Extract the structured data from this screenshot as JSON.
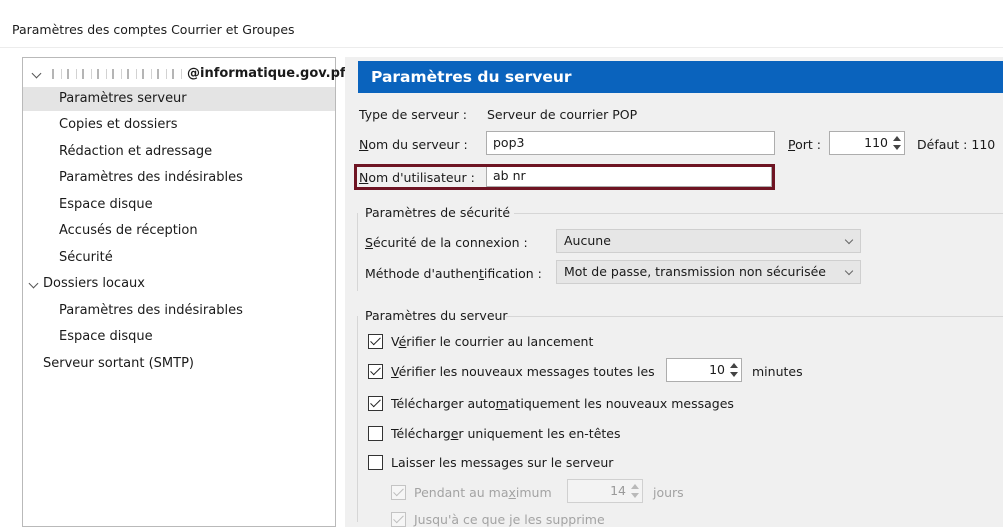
{
  "window": {
    "title": "Paramètres des comptes Courrier et Groupes"
  },
  "sidebar": {
    "account_suffix": "@informatique.gov.pf",
    "items": [
      {
        "label": "Paramètres serveur"
      },
      {
        "label": "Copies et dossiers"
      },
      {
        "label": "Rédaction et adressage"
      },
      {
        "label": "Paramètres des indésirables"
      },
      {
        "label": "Espace disque"
      },
      {
        "label": "Accusés de réception"
      },
      {
        "label": "Sécurité"
      },
      {
        "label": "Dossiers locaux"
      },
      {
        "label": "Paramètres des indésirables"
      },
      {
        "label": "Espace disque"
      },
      {
        "label": "Serveur sortant (SMTP)"
      }
    ]
  },
  "panel": {
    "title": "Paramètres du serveur",
    "server_type_label": "Type de serveur :",
    "server_type_value": "Serveur de courrier POP",
    "server_name_label": "om du serveur :",
    "server_name_mnemonic": "N",
    "server_name_value": "pop3",
    "port_label": "ort :",
    "port_mnemonic": "P",
    "port_value": "110",
    "default_label": "Défaut :",
    "default_value": "110",
    "username_label": "om d'utilisateur :",
    "username_mnemonic": "N",
    "username_value": "ab   nr"
  },
  "security": {
    "group_title": "Paramètres de sécurité",
    "connection_label": "écurité de la connexion :",
    "connection_mnemonic": "S",
    "connection_value": "Aucune",
    "auth_label_pre": "Méthode d'authen",
    "auth_label_mnemonic": "t",
    "auth_label_post": "ification :",
    "auth_value": "Mot de passe, transmission non sécurisée"
  },
  "server_settings": {
    "group_title": "Paramètres du serveur",
    "check_on_startup": {
      "pre": "V",
      "mn": "é",
      "post": "rifier le courrier au lancement",
      "checked": true
    },
    "check_every": {
      "pre": "",
      "mn": "V",
      "post": "érifier les nouveaux messages toutes les",
      "checked": true,
      "value": "10",
      "unit": "minutes"
    },
    "auto_download": {
      "pre": "Télécharger auto",
      "mn": "m",
      "post": "atiquement les nouveaux messages",
      "checked": true
    },
    "headers_only": {
      "pre": "Télécharg",
      "mn": "e",
      "post": "r uniquement les en-têtes",
      "checked": false
    },
    "leave_on_server": {
      "pre": "Laisser les messages sur le serveur",
      "mn": "",
      "post": "",
      "checked": false
    },
    "max_days": {
      "pre": "Pendant au ma",
      "mn": "x",
      "post": "imum",
      "checked": true,
      "value": "14",
      "unit": "jours"
    },
    "until_deleted": {
      "pre": "Jusqu'à ce que je les supprime",
      "checked": true
    }
  }
}
